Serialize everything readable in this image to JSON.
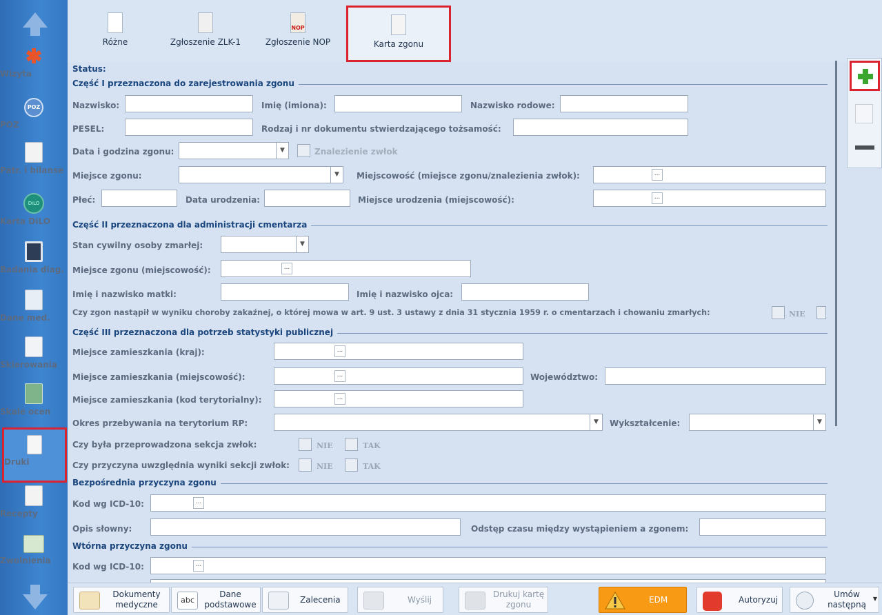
{
  "left_nav": {
    "items": [
      {
        "label": "Wizyta"
      },
      {
        "label": "POZ",
        "badge": "POZ"
      },
      {
        "label": "Patr. i bilanse"
      },
      {
        "label": "Karta DiLO",
        "badge": "DiLO"
      },
      {
        "label": "Badania diag."
      },
      {
        "label": "Dane med."
      },
      {
        "label": "Skierowania"
      },
      {
        "label": "Skale ocen"
      },
      {
        "label": "Druki"
      },
      {
        "label": "Recepty"
      },
      {
        "label": "Zwolnienia"
      }
    ]
  },
  "top_tabs": [
    {
      "label": "Różne"
    },
    {
      "label": "Zgłoszenie ZLK-1"
    },
    {
      "label": "Zgłoszenie NOP",
      "badge": "NOP"
    },
    {
      "label": "Karta zgonu"
    }
  ],
  "form": {
    "status_label": "Status:",
    "part1": {
      "title": "Część I przeznaczona do zarejestrowania zgonu",
      "nazwisko": "Nazwisko:",
      "imie": "Imię (imiona):",
      "nazwisko_rodowe": "Nazwisko rodowe:",
      "pesel": "PESEL:",
      "dokument": "Rodzaj i nr dokumentu stwierdzającego tożsamość:",
      "data_godzina": "Data i godzina zgonu:",
      "znalezienie": "Znalezienie zwłok",
      "miejsce_zgonu": "Miejsce zgonu:",
      "miejscowosc": "Miejscowość (miejsce zgonu/znalezienia zwłok):",
      "plec": "Płeć:",
      "data_urodzenia": "Data urodzenia:",
      "miejsce_urodzenia": "Miejsce urodzenia (miejscowość):"
    },
    "part2": {
      "title": "Część II przeznaczona dla administracji cmentarza",
      "stan_cywilny": "Stan cywilny osoby zmarłej:",
      "miejsce_zgonu_m": "Miejsce zgonu (miejscowość):",
      "matka": "Imię i nazwisko matki:",
      "ojciec": "Imię i nazwisko ojca:",
      "choroba": "Czy zgon nastąpił w wyniku choroby zakaźnej, o której mowa w art. 9 ust. 3 ustawy z dnia 31 stycznia 1959 r. o cmentarzach i chowaniu zmarłych:",
      "nie": "NIE"
    },
    "part3": {
      "title": "Część III przeznaczona dla potrzeb statystyki publicznej",
      "kraj": "Miejsce zamieszkania (kraj):",
      "miejscowosc": "Miejsce zamieszkania (miejscowość):",
      "wojewodztwo": "Województwo:",
      "kod_teryt": "Miejsce zamieszkania (kod terytorialny):",
      "okres": "Okres przebywania na terytorium RP:",
      "wyksztalcenie": "Wykształcenie:",
      "sekcja": "Czy była przeprowadzona sekcja zwłok:",
      "wyniki": "Czy przyczyna uwzględnia wyniki sekcji zwłok:",
      "nie": "NIE",
      "tak": "TAK"
    },
    "bezposrednia": {
      "title": "Bezpośrednia przyczyna zgonu",
      "kod": "Kod wg ICD-10:",
      "opis": "Opis słowny:",
      "odstep": "Odstęp czasu między wystąpieniem a zgonem:"
    },
    "wtorna": {
      "title": "Wtórna przyczyna zgonu",
      "kod": "Kod wg ICD-10:"
    },
    "ellipsis": "..."
  },
  "bottom_bar": {
    "dokumenty": [
      "Dokumenty",
      "medyczne"
    ],
    "dane": [
      "Dane",
      "podstawowe"
    ],
    "dane_icon_text": "abc",
    "zalecenia": "Zalecenia",
    "wyslij": "Wyślij",
    "drukuj": [
      "Drukuj kartę",
      "zgonu"
    ],
    "edm": "EDM",
    "autoryzuj": "Autoryzuj",
    "umow": [
      "Umów",
      "następną"
    ]
  },
  "colors": {
    "accent_red": "#d9232e",
    "nav_blue": "#3e85d0",
    "section_blue": "#1b467d",
    "edm_orange": "#f99a14",
    "add_green": "#3ba62e"
  }
}
